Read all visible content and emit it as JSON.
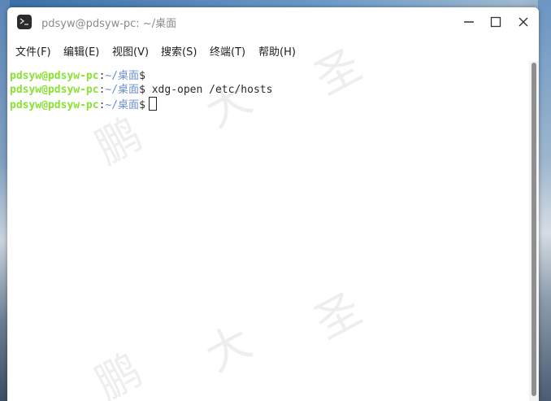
{
  "window": {
    "title": "pdsyw@pdsyw-pc: ~/桌面",
    "controls": {
      "minimize": "minimize-icon",
      "maximize": "maximize-icon",
      "close": "close-icon"
    }
  },
  "menubar": {
    "items": [
      "文件(F)",
      "编辑(E)",
      "视图(V)",
      "搜索(S)",
      "终端(T)",
      "帮助(H)"
    ]
  },
  "terminal": {
    "lines": [
      {
        "user_host": "pdsyw@pdsyw-pc",
        "sep": ":",
        "path": "~/桌面",
        "dollar": "$",
        "command": ""
      },
      {
        "user_host": "pdsyw@pdsyw-pc",
        "sep": ":",
        "path": "~/桌面",
        "dollar": "$",
        "command": "xdg-open /etc/hosts"
      },
      {
        "user_host": "pdsyw@pdsyw-pc",
        "sep": ":",
        "path": "~/桌面",
        "dollar": "$",
        "command": ""
      }
    ]
  },
  "watermark": [
    "鹏",
    "大",
    "圣",
    "鹏",
    "大",
    "圣"
  ],
  "colors": {
    "prompt_user": "#8ae234",
    "prompt_path": "#6b8fd6",
    "window_bg": "#ffffff"
  }
}
